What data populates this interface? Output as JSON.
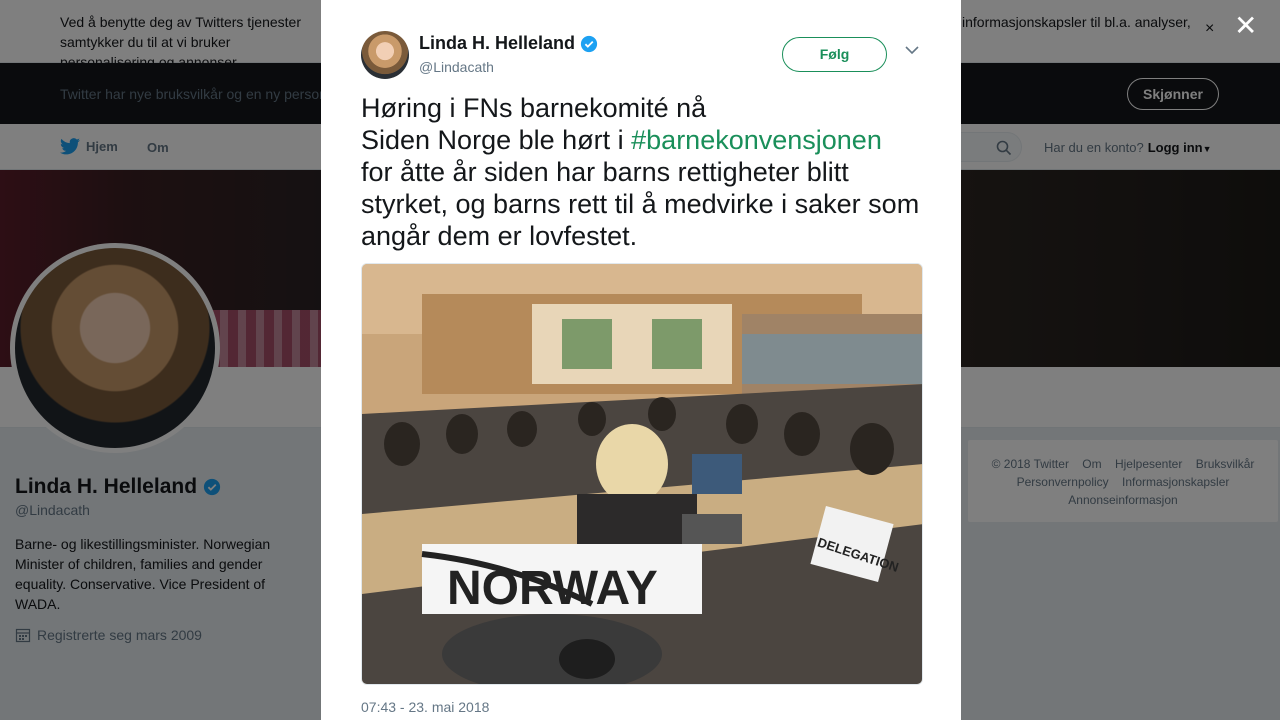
{
  "cookie": {
    "text_left": "Ved å benytte deg av Twitters tjenester samtykker du til at vi bruker personalisering og annonser.",
    "text_right": "informasjonskapsler til bl.a. analyser,",
    "text_left_line2": "personalisering og annonser."
  },
  "terms": {
    "text": "Twitter har nye bruksvilkår og en ny personvernpolicy",
    "button": "Skjønner"
  },
  "nav": {
    "home": "Hjem",
    "about": "Om",
    "account_prompt": "Har du en konto?",
    "login": "Logg inn"
  },
  "profile": {
    "name": "Linda H. Helleland",
    "handle": "@Lindacath",
    "bio": "Barne- og likestillingsminister. Norwegian Minister of children, families and gender equality. Conservative. Vice President of WADA.",
    "joined": "Registrerte seg mars 2009"
  },
  "footer": {
    "links": [
      "© 2018 Twitter",
      "Om",
      "Hjelpesenter",
      "Bruksvilkår",
      "Personvernpolicy",
      "Informasjonskapsler",
      "Annonseinformasjon"
    ]
  },
  "tweet": {
    "author_name": "Linda H. Helleland",
    "author_handle": "@Lindacath",
    "follow_label": "Følg",
    "line1": "Høring i FNs barnekomité nå",
    "line2_pre": "Siden Norge ble hørt i ",
    "hashtag": "#barnekonvensjonen",
    "line3": "for åtte år siden har barns rettigheter blitt styrket, og barns rett til å medvirke i saker som angår dem er lovfestet.",
    "photo_sign": "NORWAY",
    "photo_sign2": "DELEGATION",
    "timestamp": "07:43 - 23. mai 2018"
  },
  "colors": {
    "accent": "#1a8f5a",
    "verified": "#1da1f2",
    "overlay": "rgba(0,0,0,0.5)"
  }
}
